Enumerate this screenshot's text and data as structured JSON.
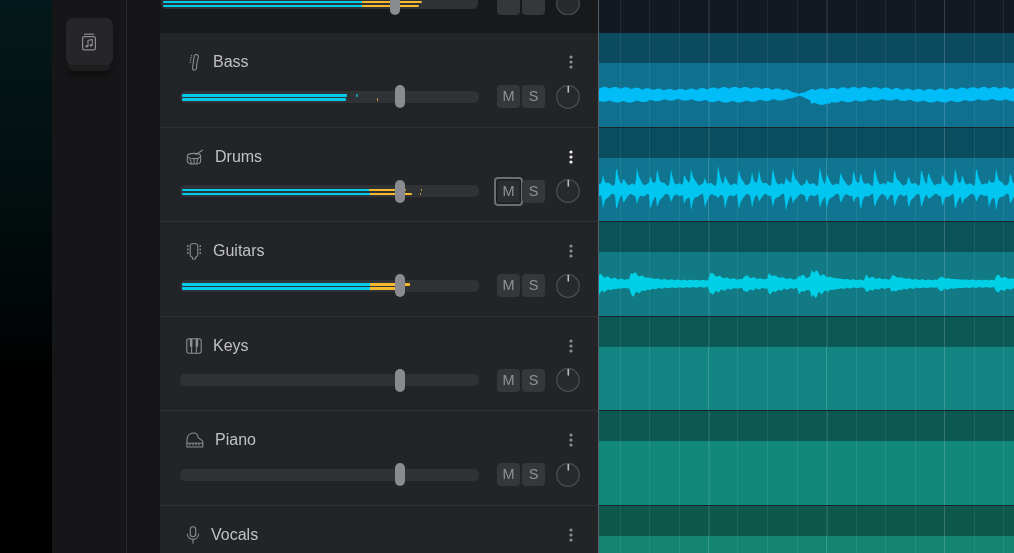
{
  "partial_track": {
    "volume": {
      "level": 0.74
    },
    "meters": [
      {
        "level": 0.827
      },
      {
        "level": 0.818
      }
    ]
  },
  "tracks": [
    {
      "name": "Bass",
      "selected": false,
      "volume": {
        "level": 0.74
      },
      "meters": [
        {
          "level": 0.558,
          "peak": {
            "level": 0.59
          }
        },
        {
          "level": 0.555,
          "peak": {
            "level": 0.66
          }
        }
      ],
      "mute": {
        "label": "M",
        "focused": false
      },
      "solo": {
        "label": "S"
      },
      "region": {
        "color": "#107090",
        "waveform": true
      }
    },
    {
      "name": "Drums",
      "selected": true,
      "volume": {
        "level": 0.74
      },
      "meters": [
        {
          "level": 0.76,
          "peak": {
            "level": 0.81
          }
        },
        {
          "level": 0.78,
          "peak": {
            "level": 0.806
          }
        }
      ],
      "mute": {
        "label": "M",
        "focused": true
      },
      "solo": {
        "label": "S"
      },
      "region": {
        "color": "#0f7590",
        "waveform": true
      }
    },
    {
      "name": "Guitars",
      "selected": false,
      "volume": {
        "level": 0.74
      },
      "meters": [
        {
          "level": 0.773
        },
        {
          "level": 0.725
        }
      ],
      "mute": {
        "label": "M",
        "focused": false
      },
      "solo": {
        "label": "S"
      },
      "region": {
        "color": "#117a85",
        "waveform": true
      }
    },
    {
      "name": "Keys",
      "selected": false,
      "volume": {
        "level": 0.74
      },
      "mute": {
        "label": "M",
        "focused": false
      },
      "solo": {
        "label": "S"
      },
      "region": {
        "color": "#128582",
        "waveform": false
      }
    },
    {
      "name": "Piano",
      "selected": false,
      "volume": {
        "level": 0.74
      },
      "mute": {
        "label": "M",
        "focused": false
      },
      "solo": {
        "label": "S"
      },
      "region": {
        "color": "#12877c",
        "waveform": false
      }
    },
    {
      "name": "Vocals",
      "selected": false,
      "region": {
        "color": "#138572",
        "waveform": false
      }
    }
  ]
}
